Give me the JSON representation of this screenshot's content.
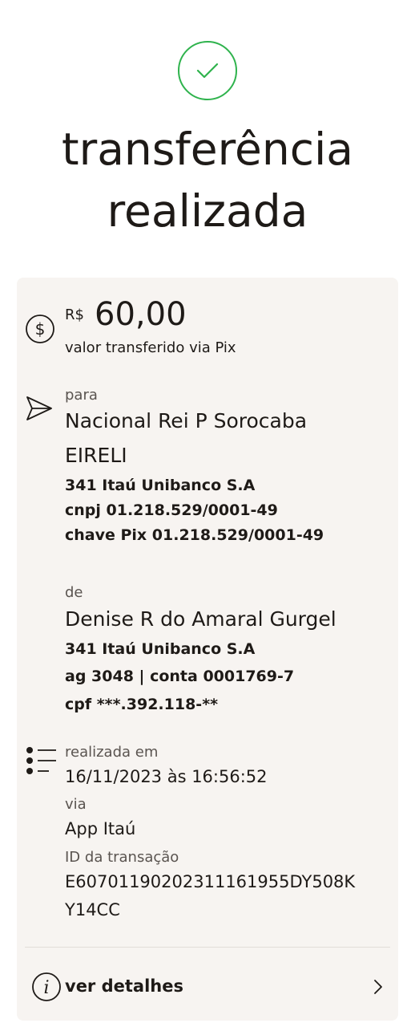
{
  "title": {
    "line1": "transferência",
    "line2": "realizada"
  },
  "icons": {
    "status": "check-circle-icon",
    "amount": "dollar-circle-icon",
    "recipient": "send-icon",
    "info": "list-icon",
    "details": "info-icon",
    "chevron": "chevron-right-icon"
  },
  "colors": {
    "success": "#2fb34d",
    "card_background": "#f7f4f1",
    "text": "#1e1a17",
    "label": "#5a5450"
  },
  "amount": {
    "currency": "R$",
    "value": "60,00",
    "caption": "valor transferido via Pix"
  },
  "recipient": {
    "label": "para",
    "name_line1": "Nacional Rei P Sorocaba",
    "name_line2": "EIRELI",
    "bank": "341 Itaú Unibanco S.A",
    "cnpj": "cnpj 01.218.529/0001-49",
    "pix_key": "chave Pix 01.218.529/0001-49"
  },
  "sender": {
    "label": "de",
    "name": "Denise R do Amaral Gurgel",
    "bank": "341 Itaú Unibanco S.A",
    "account": "ag 3048 | conta 0001769-7",
    "cpf": "cpf ***.392.118-**"
  },
  "info": {
    "date_label": "realizada em",
    "date_value": "16/11/2023 às 16:56:52",
    "via_label": "via",
    "via_value": "App Itaú",
    "id_label": "ID da transação",
    "id_line1": "E60701190202311161955DY508K",
    "id_line2": "Y14CC"
  },
  "details": {
    "label": "ver detalhes"
  }
}
